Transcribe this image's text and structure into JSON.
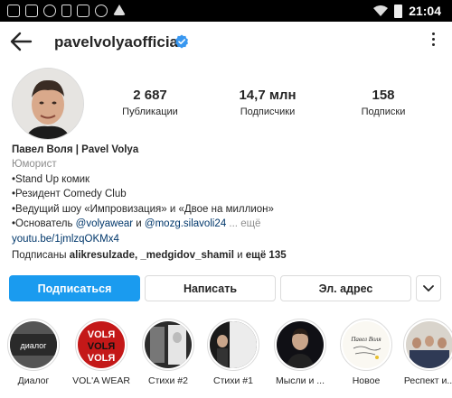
{
  "status_bar": {
    "time": "21:04"
  },
  "header": {
    "username": "pavelvolyaofficial"
  },
  "stats": [
    {
      "value": "2 687",
      "label": "Публикации"
    },
    {
      "value": "14,7 млн",
      "label": "Подписчики"
    },
    {
      "value": "158",
      "label": "Подписки"
    }
  ],
  "bio": {
    "name": "Павел Воля | Pavel Volya",
    "category": "Юморист",
    "lines": [
      "•Stand Up комик",
      "•Резидент Comedy Club",
      "•Ведущий шоу «Импровизация» и «Двое на миллион»"
    ],
    "founder_prefix": "•Основатель ",
    "founder_tag1": "@volyawear",
    "founder_and": " и ",
    "founder_tag2": "@mozg.silavoli24",
    "more": "... ещё",
    "link": "youtu.be/1jmlzqOKMx4",
    "followed_prefix": "Подписаны ",
    "followed_names": "alikresulzade, _medgidov_shamil",
    "followed_suffix": " и ",
    "followed_more": "ещё 135"
  },
  "buttons": {
    "follow": "Подписаться",
    "message": "Написать",
    "email": "Эл. адрес"
  },
  "highlights": [
    {
      "label": "Диалог"
    },
    {
      "label": "VOL'A WEAR"
    },
    {
      "label": "Стихи #2"
    },
    {
      "label": "Стихи #1"
    },
    {
      "label": "Мысли и ..."
    },
    {
      "label": "Новое"
    },
    {
      "label": "Респект и..."
    }
  ],
  "highlight_art": {
    "dialog": "диалог",
    "volya": "VOLЯ",
    "handwriting": "Павел Воля"
  },
  "colors": {
    "accent": "#1a9bef",
    "link": "#00376b",
    "verified": "#3897f0"
  }
}
